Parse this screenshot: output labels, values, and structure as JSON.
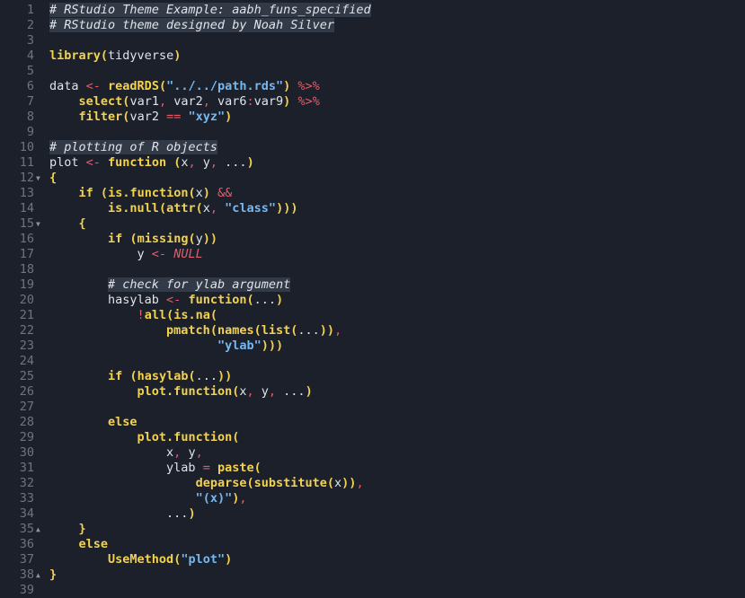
{
  "theme": {
    "background": "#1b202a",
    "gutter_text": "#6b7585",
    "default_text": "#dfe3ea",
    "keyword": "#f3d250",
    "string": "#76b8f2",
    "operator": "#e25d6c",
    "comment_highlight": "#333a47"
  },
  "fold_markers": {
    "12": "▼",
    "15": "▼",
    "35": "▲",
    "38": "▲"
  },
  "lines": [
    [
      {
        "t": "# RStudio Theme Example: aabh_funs_specified",
        "c": "cm bg"
      }
    ],
    [
      {
        "t": "# RStudio theme designed by Noah Silver",
        "c": "cm bg"
      }
    ],
    [],
    [
      {
        "t": "library",
        "c": "kw"
      },
      {
        "t": "(",
        "c": "pn"
      },
      {
        "t": "tidyverse",
        "c": "id"
      },
      {
        "t": ")",
        "c": "pn"
      }
    ],
    [],
    [
      {
        "t": "data ",
        "c": "id"
      },
      {
        "t": "<-",
        "c": "op"
      },
      {
        "t": " ",
        "c": "id"
      },
      {
        "t": "readRDS",
        "c": "kw"
      },
      {
        "t": "(",
        "c": "pn"
      },
      {
        "t": "\"../../path.rds\"",
        "c": "st"
      },
      {
        "t": ")",
        "c": "pn"
      },
      {
        "t": " ",
        "c": "id"
      },
      {
        "t": "%>%",
        "c": "op"
      }
    ],
    [
      {
        "t": "    ",
        "c": "id"
      },
      {
        "t": "select",
        "c": "kw"
      },
      {
        "t": "(",
        "c": "pn"
      },
      {
        "t": "var1",
        "c": "id"
      },
      {
        "t": ",",
        "c": "op"
      },
      {
        "t": " var2",
        "c": "id"
      },
      {
        "t": ",",
        "c": "op"
      },
      {
        "t": " var6",
        "c": "id"
      },
      {
        "t": ":",
        "c": "op"
      },
      {
        "t": "var9",
        "c": "id"
      },
      {
        "t": ")",
        "c": "pn"
      },
      {
        "t": " ",
        "c": "id"
      },
      {
        "t": "%>%",
        "c": "op"
      }
    ],
    [
      {
        "t": "    ",
        "c": "id"
      },
      {
        "t": "filter",
        "c": "kw"
      },
      {
        "t": "(",
        "c": "pn"
      },
      {
        "t": "var2 ",
        "c": "id"
      },
      {
        "t": "==",
        "c": "op"
      },
      {
        "t": " ",
        "c": "id"
      },
      {
        "t": "\"xyz\"",
        "c": "st"
      },
      {
        "t": ")",
        "c": "pn"
      }
    ],
    [],
    [
      {
        "t": "# plotting of R objects",
        "c": "cm bg"
      }
    ],
    [
      {
        "t": "plot ",
        "c": "id"
      },
      {
        "t": "<-",
        "c": "op"
      },
      {
        "t": " ",
        "c": "id"
      },
      {
        "t": "function",
        "c": "kw"
      },
      {
        "t": " ",
        "c": "id"
      },
      {
        "t": "(",
        "c": "pn"
      },
      {
        "t": "x",
        "c": "id"
      },
      {
        "t": ",",
        "c": "op"
      },
      {
        "t": " y",
        "c": "id"
      },
      {
        "t": ",",
        "c": "op"
      },
      {
        "t": " ...",
        "c": "id"
      },
      {
        "t": ")",
        "c": "pn"
      }
    ],
    [
      {
        "t": "{",
        "c": "pn"
      }
    ],
    [
      {
        "t": "    ",
        "c": "id"
      },
      {
        "t": "if",
        "c": "kw"
      },
      {
        "t": " ",
        "c": "id"
      },
      {
        "t": "(",
        "c": "pn"
      },
      {
        "t": "is.function",
        "c": "kw"
      },
      {
        "t": "(",
        "c": "pn"
      },
      {
        "t": "x",
        "c": "id"
      },
      {
        "t": ")",
        "c": "pn"
      },
      {
        "t": " ",
        "c": "id"
      },
      {
        "t": "&&",
        "c": "op"
      }
    ],
    [
      {
        "t": "        ",
        "c": "id"
      },
      {
        "t": "is.null",
        "c": "kw"
      },
      {
        "t": "(",
        "c": "pn"
      },
      {
        "t": "attr",
        "c": "kw"
      },
      {
        "t": "(",
        "c": "pn"
      },
      {
        "t": "x",
        "c": "id"
      },
      {
        "t": ",",
        "c": "op"
      },
      {
        "t": " ",
        "c": "id"
      },
      {
        "t": "\"class\"",
        "c": "st"
      },
      {
        "t": ")))",
        "c": "pn"
      }
    ],
    [
      {
        "t": "    ",
        "c": "id"
      },
      {
        "t": "{",
        "c": "pn"
      }
    ],
    [
      {
        "t": "        ",
        "c": "id"
      },
      {
        "t": "if",
        "c": "kw"
      },
      {
        "t": " ",
        "c": "id"
      },
      {
        "t": "(",
        "c": "pn"
      },
      {
        "t": "missing",
        "c": "kw"
      },
      {
        "t": "(",
        "c": "pn"
      },
      {
        "t": "y",
        "c": "id"
      },
      {
        "t": "))",
        "c": "pn"
      }
    ],
    [
      {
        "t": "            y ",
        "c": "id"
      },
      {
        "t": "<-",
        "c": "op"
      },
      {
        "t": " ",
        "c": "id"
      },
      {
        "t": "NULL",
        "c": "nl"
      }
    ],
    [],
    [
      {
        "t": "        ",
        "c": "id"
      },
      {
        "t": "# check for ylab argument",
        "c": "cm bg"
      }
    ],
    [
      {
        "t": "        hasylab ",
        "c": "id"
      },
      {
        "t": "<-",
        "c": "op"
      },
      {
        "t": " ",
        "c": "id"
      },
      {
        "t": "function",
        "c": "kw"
      },
      {
        "t": "(",
        "c": "pn"
      },
      {
        "t": "...",
        "c": "id"
      },
      {
        "t": ")",
        "c": "pn"
      }
    ],
    [
      {
        "t": "            ",
        "c": "id"
      },
      {
        "t": "!",
        "c": "op"
      },
      {
        "t": "all",
        "c": "kw"
      },
      {
        "t": "(",
        "c": "pn"
      },
      {
        "t": "is.na",
        "c": "kw"
      },
      {
        "t": "(",
        "c": "pn"
      }
    ],
    [
      {
        "t": "                ",
        "c": "id"
      },
      {
        "t": "pmatch",
        "c": "kw"
      },
      {
        "t": "(",
        "c": "pn"
      },
      {
        "t": "names",
        "c": "kw"
      },
      {
        "t": "(",
        "c": "pn"
      },
      {
        "t": "list",
        "c": "kw"
      },
      {
        "t": "(",
        "c": "pn"
      },
      {
        "t": "...",
        "c": "id"
      },
      {
        "t": "))",
        "c": "pn"
      },
      {
        "t": ",",
        "c": "op"
      }
    ],
    [
      {
        "t": "                       ",
        "c": "id"
      },
      {
        "t": "\"ylab\"",
        "c": "st"
      },
      {
        "t": ")))",
        "c": "pn"
      }
    ],
    [],
    [
      {
        "t": "        ",
        "c": "id"
      },
      {
        "t": "if",
        "c": "kw"
      },
      {
        "t": " ",
        "c": "id"
      },
      {
        "t": "(",
        "c": "pn"
      },
      {
        "t": "hasylab",
        "c": "kw"
      },
      {
        "t": "(",
        "c": "pn"
      },
      {
        "t": "...",
        "c": "id"
      },
      {
        "t": "))",
        "c": "pn"
      }
    ],
    [
      {
        "t": "            ",
        "c": "id"
      },
      {
        "t": "plot.function",
        "c": "kw"
      },
      {
        "t": "(",
        "c": "pn"
      },
      {
        "t": "x",
        "c": "id"
      },
      {
        "t": ",",
        "c": "op"
      },
      {
        "t": " y",
        "c": "id"
      },
      {
        "t": ",",
        "c": "op"
      },
      {
        "t": " ...",
        "c": "id"
      },
      {
        "t": ")",
        "c": "pn"
      }
    ],
    [],
    [
      {
        "t": "        ",
        "c": "id"
      },
      {
        "t": "else",
        "c": "kw"
      }
    ],
    [
      {
        "t": "            ",
        "c": "id"
      },
      {
        "t": "plot.function",
        "c": "kw"
      },
      {
        "t": "(",
        "c": "pn"
      }
    ],
    [
      {
        "t": "                x",
        "c": "id"
      },
      {
        "t": ",",
        "c": "op"
      },
      {
        "t": " y",
        "c": "id"
      },
      {
        "t": ",",
        "c": "op"
      }
    ],
    [
      {
        "t": "                ylab ",
        "c": "id"
      },
      {
        "t": "=",
        "c": "op"
      },
      {
        "t": " ",
        "c": "id"
      },
      {
        "t": "paste",
        "c": "kw"
      },
      {
        "t": "(",
        "c": "pn"
      }
    ],
    [
      {
        "t": "                    ",
        "c": "id"
      },
      {
        "t": "deparse",
        "c": "kw"
      },
      {
        "t": "(",
        "c": "pn"
      },
      {
        "t": "substitute",
        "c": "kw"
      },
      {
        "t": "(",
        "c": "pn"
      },
      {
        "t": "x",
        "c": "id"
      },
      {
        "t": "))",
        "c": "pn"
      },
      {
        "t": ",",
        "c": "op"
      }
    ],
    [
      {
        "t": "                    ",
        "c": "id"
      },
      {
        "t": "\"(x)\"",
        "c": "st"
      },
      {
        "t": ")",
        "c": "pn"
      },
      {
        "t": ",",
        "c": "op"
      }
    ],
    [
      {
        "t": "                ...",
        "c": "id"
      },
      {
        "t": ")",
        "c": "pn"
      }
    ],
    [
      {
        "t": "    ",
        "c": "id"
      },
      {
        "t": "}",
        "c": "pn"
      }
    ],
    [
      {
        "t": "    ",
        "c": "id"
      },
      {
        "t": "else",
        "c": "kw"
      }
    ],
    [
      {
        "t": "        ",
        "c": "id"
      },
      {
        "t": "UseMethod",
        "c": "kw"
      },
      {
        "t": "(",
        "c": "pn"
      },
      {
        "t": "\"plot\"",
        "c": "st"
      },
      {
        "t": ")",
        "c": "pn"
      }
    ],
    [
      {
        "t": "}",
        "c": "pn"
      }
    ],
    []
  ],
  "line_numbers": [
    "1",
    "2",
    "3",
    "4",
    "5",
    "6",
    "7",
    "8",
    "9",
    "10",
    "11",
    "12",
    "13",
    "14",
    "15",
    "16",
    "17",
    "18",
    "19",
    "20",
    "21",
    "22",
    "23",
    "24",
    "25",
    "26",
    "27",
    "28",
    "29",
    "30",
    "31",
    "32",
    "33",
    "34",
    "35",
    "36",
    "37",
    "38",
    "39"
  ]
}
